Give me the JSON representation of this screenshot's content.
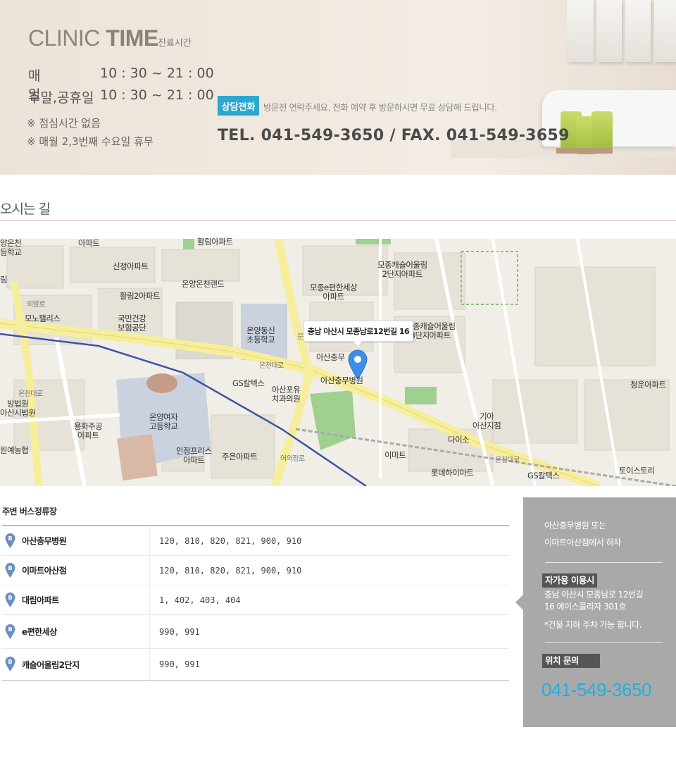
{
  "banner": {
    "title_light": "CLINIC",
    "title_bold": "TIME",
    "subtitle": "진료시간",
    "hours": [
      {
        "label": "매일",
        "value": "10 : 30 ~ 21 : 00"
      },
      {
        "label": "주말,공휴일",
        "value": "10 : 30 ~ 21 : 00"
      }
    ],
    "notes": [
      "※ 점심시간 없음",
      "※ 매월 2,3번째 수요일 휴무"
    ],
    "consult_badge": "상담전화",
    "consult_text": "방문전 연락주세요. 전화 예약 후 방문하시면 무료 상담해 드립니다.",
    "tel_line": "TEL. 041-549-3650  / FAX. 041-549-3659"
  },
  "section": {
    "title": "오시는 길"
  },
  "map": {
    "callout": "충남 아산시 모종남로12번길 16",
    "labels": [
      "양온천\n등학교",
      "아파트",
      "활림아파트",
      "신정아파트",
      "온양온천랜드",
      "모종캐슬어울림\n2단지아파트",
      "모종e편한세상\n아파트",
      "림",
      "모노팰리스",
      "활림2아파트",
      "국민건강\n보험공단",
      "온양동신\n초등학교",
      "모종캐슬어울림\n3단지아파트",
      "아산충무",
      "아산충무병원",
      "GS칼텍스",
      "아산포유\n치과의원",
      "청운아파트",
      "방법원\n아산시법원",
      "용화주공\n아파트",
      "온양여자\n고등학교",
      "기아\n아산지점",
      "다이소",
      "원예농협",
      "인정프리스\n아파트",
      "주은아파트",
      "이마트",
      "롯데하이마트",
      "GS칼텍스",
      "토이스토리",
      "온천대로",
      "온천대로",
      "문화로",
      "외암로",
      "어의정로",
      "온천대로"
    ]
  },
  "bus": {
    "title": "주변 버스정류장",
    "icon_letter": "B",
    "rows": [
      {
        "name": "아산충무병원",
        "routes": "120, 810, 820, 821, 900, 910"
      },
      {
        "name": "이마트아산점",
        "routes": "120, 810, 820, 821, 900, 910"
      },
      {
        "name": "대림아파트",
        "routes": "1, 402, 403, 404"
      },
      {
        "name": "e편한세상",
        "routes": "990, 991"
      },
      {
        "name": "캐슬어울림2단지",
        "routes": "990, 991"
      }
    ]
  },
  "side": {
    "intro_line1": "아산충무병원 또는",
    "intro_line2": "이마트아산점에서 하차",
    "car_tag": "자가용 이용시",
    "address_line1": "충남 아산시 모종남로 12번길",
    "address_line2": "16 에이스플라자 301호",
    "parking_note": "*건물 지하 주차 가능 합니다.",
    "location_tag": "위치 문의",
    "phone": "041-549-3650"
  },
  "colors": {
    "accent": "#2aa8d0",
    "phone": "#24aee0",
    "side_bg": "#a9a9a9",
    "pin": "#3b8fe6"
  }
}
